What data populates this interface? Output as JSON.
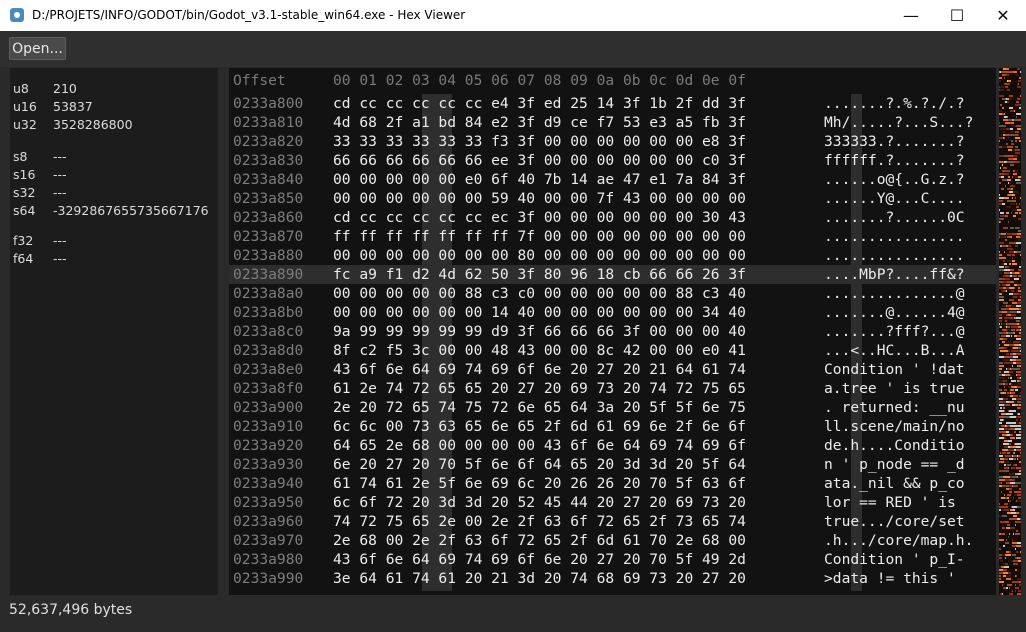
{
  "window": {
    "title": "D:/PROJETS/INFO/GODOT/bin/Godot_v3.1-stable_win64.exe - Hex Viewer",
    "minimize": "—",
    "maximize": "☐",
    "close": "✕"
  },
  "toolbar": {
    "open_label": "Open..."
  },
  "inspector": [
    {
      "type": "u8",
      "value": "210"
    },
    {
      "type": "u16",
      "value": "53837"
    },
    {
      "type": "u32",
      "value": "3528286800"
    },
    {
      "type": "s8",
      "value": "---"
    },
    {
      "type": "s16",
      "value": "---"
    },
    {
      "type": "s32",
      "value": "---"
    },
    {
      "type": "s64",
      "value": "-3292867655735667176"
    },
    {
      "type": "f32",
      "value": "---"
    },
    {
      "type": "f64",
      "value": "---"
    }
  ],
  "hex_view": {
    "header_offset": "Offset",
    "header_columns": "00 01 02 03 04 05 06 07 08 09 0a 0b 0c 0d 0e 0f",
    "selected_row": 9,
    "rows": [
      {
        "offset": "0233a800",
        "hex": "cd cc cc cc cc cc e4 3f ed 25 14 3f 1b 2f dd 3f",
        "ascii": ".......?.%.?./.?"
      },
      {
        "offset": "0233a810",
        "hex": "4d 68 2f a1 bd 84 e2 3f d9 ce f7 53 e3 a5 fb 3f",
        "ascii": "Mh/.....?...S...?"
      },
      {
        "offset": "0233a820",
        "hex": "33 33 33 33 33 33 f3 3f 00 00 00 00 00 00 e8 3f",
        "ascii": "333333.?.......?"
      },
      {
        "offset": "0233a830",
        "hex": "66 66 66 66 66 66 ee 3f 00 00 00 00 00 00 c0 3f",
        "ascii": "ffffff.?.......?"
      },
      {
        "offset": "0233a840",
        "hex": "00 00 00 00 00 e0 6f 40 7b 14 ae 47 e1 7a 84 3f",
        "ascii": "......o@{..G.z.?"
      },
      {
        "offset": "0233a850",
        "hex": "00 00 00 00 00 00 59 40 00 00 7f 43 00 00 00 00",
        "ascii": "......Y@...C...."
      },
      {
        "offset": "0233a860",
        "hex": "cd cc cc cc cc cc ec 3f 00 00 00 00 00 00 30 43",
        "ascii": ".......?......0C"
      },
      {
        "offset": "0233a870",
        "hex": "ff ff ff ff ff ff ff 7f 00 00 00 00 00 00 00 00",
        "ascii": "................"
      },
      {
        "offset": "0233a880",
        "hex": "00 00 00 00 00 00 00 80 00 00 00 00 00 00 00 00",
        "ascii": "................"
      },
      {
        "offset": "0233a890",
        "hex": "fc a9 f1 d2 4d 62 50 3f 80 96 18 cb 66 66 26 3f",
        "ascii": "....MbP?....ff&?"
      },
      {
        "offset": "0233a8a0",
        "hex": "00 00 00 00 00 88 c3 c0 00 00 00 00 00 88 c3 40",
        "ascii": "...............@"
      },
      {
        "offset": "0233a8b0",
        "hex": "00 00 00 00 00 00 14 40 00 00 00 00 00 00 34 40",
        "ascii": ".......@......4@"
      },
      {
        "offset": "0233a8c0",
        "hex": "9a 99 99 99 99 99 d9 3f 66 66 66 3f 00 00 00 40",
        "ascii": ".......?fff?...@"
      },
      {
        "offset": "0233a8d0",
        "hex": "8f c2 f5 3c 00 00 48 43 00 00 8c 42 00 00 e0 41",
        "ascii": "...<..HC...B...A"
      },
      {
        "offset": "0233a8e0",
        "hex": "43 6f 6e 64 69 74 69 6f 6e 20 27 20 21 64 61 74",
        "ascii": "Condition ' !dat"
      },
      {
        "offset": "0233a8f0",
        "hex": "61 2e 74 72 65 65 20 27 20 69 73 20 74 72 75 65",
        "ascii": "a.tree ' is true"
      },
      {
        "offset": "0233a900",
        "hex": "2e 20 72 65 74 75 72 6e 65 64 3a 20 5f 5f 6e 75",
        "ascii": ". returned: __nu"
      },
      {
        "offset": "0233a910",
        "hex": "6c 6c 00 73 63 65 6e 65 2f 6d 61 69 6e 2f 6e 6f",
        "ascii": "ll.scene/main/no"
      },
      {
        "offset": "0233a920",
        "hex": "64 65 2e 68 00 00 00 00 43 6f 6e 64 69 74 69 6f",
        "ascii": "de.h....Conditio"
      },
      {
        "offset": "0233a930",
        "hex": "6e 20 27 20 70 5f 6e 6f 64 65 20 3d 3d 20 5f 64",
        "ascii": "n ' p_node == _d"
      },
      {
        "offset": "0233a940",
        "hex": "61 74 61 2e 5f 6e 69 6c 20 26 26 20 70 5f 63 6f",
        "ascii": "ata._nil && p_co"
      },
      {
        "offset": "0233a950",
        "hex": "6c 6f 72 20 3d 3d 20 52 45 44 20 27 20 69 73 20",
        "ascii": "lor == RED ' is "
      },
      {
        "offset": "0233a960",
        "hex": "74 72 75 65 2e 00 2e 2f 63 6f 72 65 2f 73 65 74",
        "ascii": "true.../core/set"
      },
      {
        "offset": "0233a970",
        "hex": "2e 68 00 2e 2f 63 6f 72 65 2f 6d 61 70 2e 68 00",
        "ascii": ".h.../core/map.h."
      },
      {
        "offset": "0233a980",
        "hex": "43 6f 6e 64 69 74 69 6f 6e 20 27 20 70 5f 49 2d",
        "ascii": "Condition ' p_I-"
      },
      {
        "offset": "0233a990",
        "hex": "3e 64 61 74 61 20 21 3d 20 74 68 69 73 20 27 20",
        "ascii": ">data != this ' "
      }
    ]
  },
  "minimap": {
    "label": "file overview minimap"
  },
  "status": {
    "file_size": "52,637,496 bytes"
  },
  "colors": {
    "background": "#2a2a2a",
    "panel": "#1c1c1c",
    "hex_background": "#121212",
    "highlight": "#2e2e2e",
    "text": "#ececec",
    "offset_text": "#7e7e7e"
  }
}
